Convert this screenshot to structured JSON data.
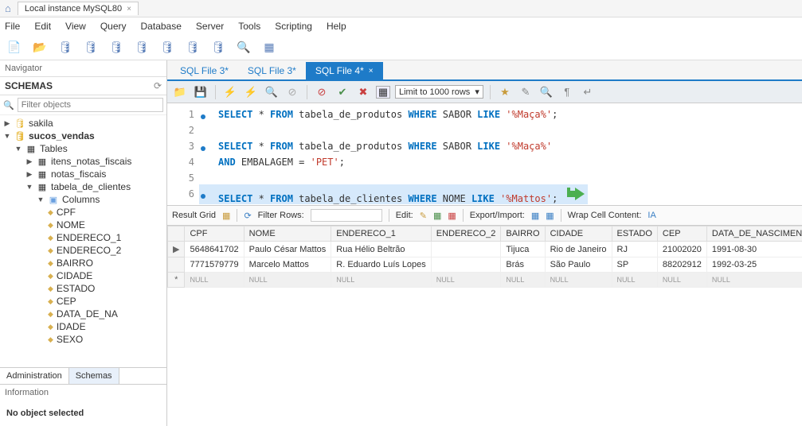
{
  "title_tab": "Local instance MySQL80",
  "menu": [
    "File",
    "Edit",
    "View",
    "Query",
    "Database",
    "Server",
    "Tools",
    "Scripting",
    "Help"
  ],
  "navigator_label": "Navigator",
  "schemas_label": "SCHEMAS",
  "filter_placeholder": "Filter objects",
  "tree": {
    "sakila": "sakila",
    "sucos": "sucos_vendas",
    "tables": "Tables",
    "t1": "itens_notas_fiscais",
    "t2": "notas_fiscais",
    "t3": "tabela_de_clientes",
    "columns": "Columns",
    "cols": [
      "CPF",
      "NOME",
      "ENDERECO_1",
      "ENDERECO_2",
      "BAIRRO",
      "CIDADE",
      "ESTADO",
      "CEP",
      "DATA_DE_NA",
      "IDADE",
      "SEXO"
    ]
  },
  "nav_tabs": {
    "admin": "Administration",
    "schemas": "Schemas"
  },
  "info_label": "Information",
  "no_object": "No object selected",
  "file_tabs": [
    "SQL File 3*",
    "SQL File 3*",
    "SQL File 4*"
  ],
  "limit_label": "Limit to 1000 rows",
  "code": {
    "l1a": "SELECT",
    "l1b": " * ",
    "l1c": "FROM",
    "l1d": " tabela_de_produtos ",
    "l1e": "WHERE",
    "l1f": " SABOR ",
    "l1g": "LIKE",
    "l1h": " '%Maça%'",
    "l1i": ";",
    "l3a": "SELECT",
    "l3b": " * ",
    "l3c": "FROM",
    "l3d": " tabela_de_produtos ",
    "l3e": "WHERE",
    "l3f": " SABOR ",
    "l3g": "LIKE",
    "l3h": " '%Maça%'",
    "l4a": "AND",
    "l4b": " EMBALAGEM = ",
    "l4c": "'PET'",
    "l4d": ";",
    "l6a": "SELECT",
    "l6b": " * ",
    "l6c": "FROM",
    "l6d": " tabela_de_clientes ",
    "l6e": "WHERE",
    "l6f": " NOME ",
    "l6g": "LIKE",
    "l6h": " '%Mattos'",
    "l6i": ";"
  },
  "line_nums": [
    "1",
    "2",
    "3",
    "4",
    "5",
    "6"
  ],
  "result_bar": {
    "grid": "Result Grid",
    "filter": "Filter Rows:",
    "edit": "Edit:",
    "export": "Export/Import:",
    "wrap": "Wrap Cell Content:"
  },
  "grid": {
    "headers": [
      "CPF",
      "NOME",
      "ENDERECO_1",
      "ENDERECO_2",
      "BAIRRO",
      "CIDADE",
      "ESTADO",
      "CEP",
      "DATA_DE_NASCIMEN"
    ],
    "rows": [
      [
        "5648641702",
        "Paulo César Mattos",
        "Rua Hélio Beltrão",
        "",
        "Tijuca",
        "Rio de Janeiro",
        "RJ",
        "21002020",
        "1991-08-30"
      ],
      [
        "7771579779",
        "Marcelo Mattos",
        "R. Eduardo Luís Lopes",
        "",
        "Brás",
        "São Paulo",
        "SP",
        "88202912",
        "1992-03-25"
      ]
    ],
    "null": "NULL"
  }
}
